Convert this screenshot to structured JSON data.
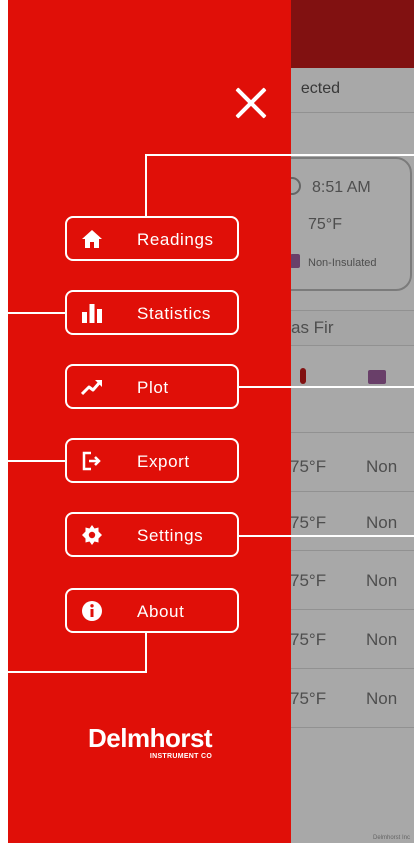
{
  "background": {
    "status_text": "ected",
    "card_time": "8:51 AM",
    "card_temp": "75°F",
    "card_insulation": "Non-Insulated",
    "species": "as Fir",
    "rows": [
      {
        "temp": "75°F",
        "insulation": "Non"
      },
      {
        "temp": "75°F",
        "insulation": "Non"
      },
      {
        "temp": "75°F",
        "insulation": "Non"
      },
      {
        "temp": "75°F",
        "insulation": "Non"
      },
      {
        "temp": "75°F",
        "insulation": "Non"
      }
    ],
    "footer_credit": "Delmhorst Inc"
  },
  "drawer": {
    "color": "#e00f08",
    "menu": [
      {
        "label": "Readings",
        "icon": "home-icon"
      },
      {
        "label": "Statistics",
        "icon": "bar-chart-icon"
      },
      {
        "label": "Plot",
        "icon": "trending-up-icon"
      },
      {
        "label": "Export",
        "icon": "export-icon"
      },
      {
        "label": "Settings",
        "icon": "gear-icon"
      },
      {
        "label": "About",
        "icon": "info-icon"
      }
    ],
    "close_icon": "close-icon",
    "logo": {
      "main": "Delmhorst",
      "sub": "INSTRUMENT CO"
    }
  }
}
